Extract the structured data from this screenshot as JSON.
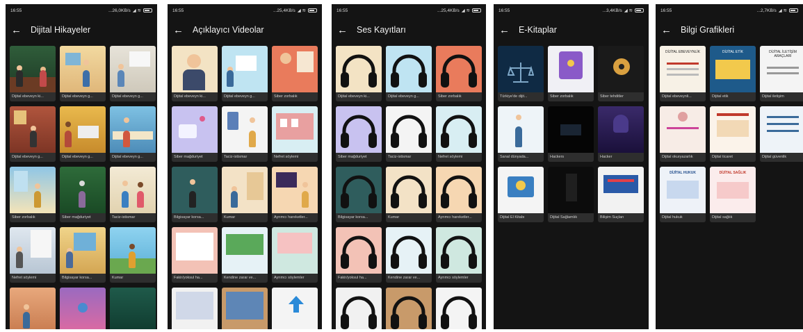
{
  "status": {
    "time": "16:55"
  },
  "screens": [
    {
      "title": "Dijital Hikayeler",
      "speed": "...26,0KB/s",
      "items": [
        "Dijital ebeveyn ki...",
        "Dijital ebeveyn g...",
        "Dijital ebeveyn g...",
        "Dijital ebeveyn g...",
        "Dijital ebeveyn g...",
        "Dijital ebeveyn g...",
        "Siber zorbalık",
        "Siber mağduriyet",
        "Taciz-istismar",
        "Nefret söylemi",
        "Bilgisayar korsa...",
        "Kumar",
        "",
        "",
        ""
      ]
    },
    {
      "title": "Açıklayıcı Videolar",
      "speed": "...25,4KB/s",
      "items": [
        "Dijital ebeveyn ki...",
        "Dijital ebeveyn g...",
        "Siber zorbalık",
        "Siber mağduriyet",
        "Taciz-istismar",
        "Nefret söylemi",
        "Bilgisayar korsa...",
        "Kumar",
        "Ayrımcı hareketler...",
        "Fakir/yoksul ha...",
        "Kendine zarar ve...",
        "Ayrımcı söylemler",
        "",
        "",
        ""
      ]
    },
    {
      "title": "Ses Kayıtları",
      "speed": "...25,4KB/s",
      "items": [
        "Dijital ebeveyn ki...",
        "Dijital ebeveyn g...",
        "Siber zorbalık",
        "Siber mağduriyet",
        "Taciz-istismar",
        "Nefret söylemi",
        "Bilgisayar korsa...",
        "Kumar",
        "Ayrımcı hareketler...",
        "Fakir/yoksul ha...",
        "Kendine zarar ve...",
        "Ayrımcı söylemler",
        "",
        "",
        ""
      ]
    },
    {
      "title": "E-Kitaplar",
      "speed": "...3,4KB/s",
      "items": [
        "Türkiye'de dijit...",
        "Siber zorbalık",
        "Siber tehditler",
        "Sanal dünyada...",
        "Hackers",
        "Hacker",
        "Dijital El Kitabı",
        "Dijital Sağlamlık",
        "Bilişim Suçları"
      ]
    },
    {
      "title": "Bilgi Grafikleri",
      "speed": "...2,7KB/s",
      "items": [
        "Dijital ebeveynli...",
        "Dijital etik",
        "Dijital iletişim",
        "Dijital okuryazarlık",
        "Dijital ticaret",
        "Dijital güvenlik",
        "Dijital hukuk",
        "Dijital sağlık"
      ],
      "covers": [
        "DİJİTAL EBEVEYNLİK",
        "DİJİTAL ETİK",
        "DİJİTAL İLETİŞİM ARAÇLARI",
        "",
        "",
        "",
        "DİJİTAL HUKUK",
        "DİJİTAL SAĞLIK"
      ]
    }
  ],
  "colors": {
    "background": "#141414",
    "caption_bg": "#2e2e2e",
    "text": "#ffffff"
  }
}
